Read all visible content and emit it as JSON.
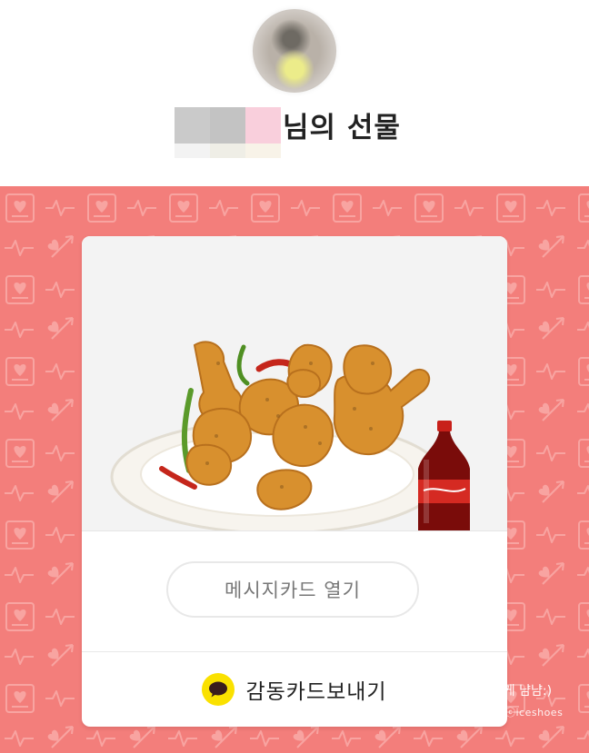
{
  "sender": {
    "title_suffix": "님의 선물"
  },
  "card": {
    "open_message_label": "메시지카드 열기",
    "send_thanks_label": "감동카드보내기"
  },
  "overlay": {
    "caption": "맛있게 냠냠:)",
    "watermark": "ⓒiceshoes"
  },
  "colors": {
    "pattern_background": "#f37e7b",
    "talk_icon": "#fae100"
  },
  "icons": {
    "talk": "kakaotalk-bubble-icon"
  }
}
